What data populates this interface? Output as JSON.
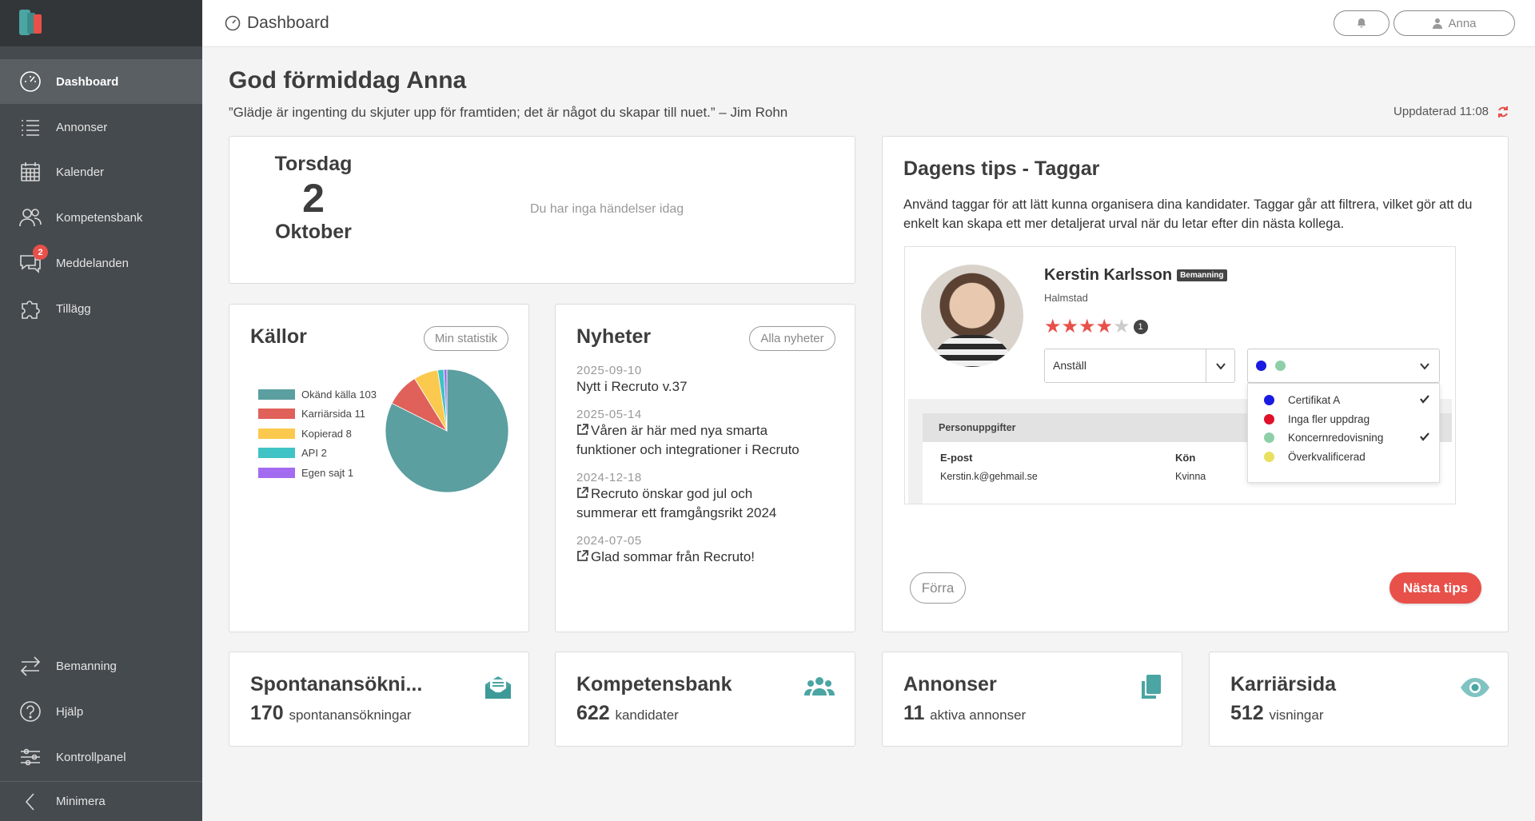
{
  "app": {
    "logo_colors": [
      "#4aa5a3",
      "#e8504a"
    ]
  },
  "sidebar": {
    "items": [
      {
        "label": "Dashboard",
        "icon": "dashboard-gauge-icon",
        "active": true
      },
      {
        "label": "Annonser",
        "icon": "list-icon"
      },
      {
        "label": "Kalender",
        "icon": "calendar-icon"
      },
      {
        "label": "Kompetensbank",
        "icon": "people-icon"
      },
      {
        "label": "Meddelanden",
        "icon": "chat-icon",
        "badge": "2"
      },
      {
        "label": "Tillägg",
        "icon": "puzzle-icon"
      }
    ],
    "bottom_items": [
      {
        "label": "Bemanning",
        "icon": "swap-arrows-icon"
      },
      {
        "label": "Hjälp",
        "icon": "help-icon"
      },
      {
        "label": "Kontrollpanel",
        "icon": "sliders-icon"
      },
      {
        "label": "Minimera",
        "icon": "chevron-left-icon"
      }
    ]
  },
  "topbar": {
    "title": "Dashboard",
    "user_label": "Anna"
  },
  "main": {
    "greeting": "God förmiddag Anna",
    "quote": "”Glädje är ingenting du skjuter upp för framtiden; det är något du skapar till nuet.”  – Jim Rohn",
    "updated": "Uppdaterad 11:08"
  },
  "date_card": {
    "weekday": "Torsdag",
    "day": "2",
    "month": "Oktober",
    "no_events": "Du har inga händelser idag"
  },
  "sources": {
    "title": "Källor",
    "button": "Min statistik",
    "chart_data": {
      "type": "pie",
      "categories": [
        "Okänd källa",
        "Karriärsida",
        "Kopierad",
        "API",
        "Egen sajt"
      ],
      "values": [
        103,
        11,
        8,
        2,
        1
      ],
      "legend_labels": [
        "Okänd källa 103",
        "Karriärsida 11",
        "Kopierad 8",
        "API 2",
        "Egen sajt 1"
      ],
      "colors": [
        "#5b9fa0",
        "#e0605a",
        "#fcc94f",
        "#40c3c4",
        "#a36cf0"
      ],
      "legend": "left"
    }
  },
  "news": {
    "title": "Nyheter",
    "button": "Alla nyheter",
    "items": [
      {
        "date": "2025-09-10",
        "text": "Nytt i Recruto v.37",
        "external": false
      },
      {
        "date": "2025-05-14",
        "text": "Våren är här med nya smarta funktioner och integrationer i Recruto",
        "external": true
      },
      {
        "date": "2024-12-18",
        "text": "Recruto önskar god jul och summerar ett framgångsrikt 2024",
        "external": true
      },
      {
        "date": "2024-07-05",
        "text": "Glad sommar från Recruto!",
        "external": true
      }
    ]
  },
  "tips": {
    "title": "Dagens tips - Taggar",
    "text": "Använd taggar för att lätt kunna organisera dina kandidater. Taggar går att filtrera, vilket gör att du enkelt kan skapa ett mer detaljerat urval när du letar efter din nästa kollega.",
    "candidate": {
      "name": "Kerstin Karlsson",
      "tag": "Bemanning",
      "city": "Halmstad",
      "rating": 4,
      "rating_max": 5,
      "rating_count": "1",
      "status_select": "Anställ",
      "selected_tag_colors": [
        "#1a1ae0",
        "#8fcfa8"
      ],
      "tag_options": [
        {
          "label": "Certifikat A",
          "color": "#1a1ae0",
          "checked": true
        },
        {
          "label": "Inga fler uppdrag",
          "color": "#e0102a",
          "checked": false
        },
        {
          "label": "Koncernredovisning",
          "color": "#8fcfa8",
          "checked": true
        },
        {
          "label": "Överkvalificerad",
          "color": "#e8e060",
          "checked": false
        }
      ],
      "section_title": "Personuppgifter",
      "email_label": "E-post",
      "email_value": "Kerstin.k@gehmail.se",
      "gender_label": "Kön",
      "gender_value": "Kvinna"
    },
    "prev_label": "Förra",
    "next_label": "Nästa tips"
  },
  "stats": [
    {
      "title": "Spontanansökni...",
      "value": "170",
      "unit": "spontanansökningar",
      "icon": "envelope-open-icon"
    },
    {
      "title": "Kompetensbank",
      "value": "622",
      "unit": "kandidater",
      "icon": "users-group-icon"
    },
    {
      "title": "Annonser",
      "value": "11",
      "unit": "aktiva annonser",
      "icon": "copy-documents-icon"
    },
    {
      "title": "Karriärsida",
      "value": "512",
      "unit": "visningar",
      "icon": "eye-icon"
    }
  ],
  "colors": {
    "accent": "#e8504a",
    "teal": "#4aa5a3",
    "sidebar": "#454a4e"
  }
}
